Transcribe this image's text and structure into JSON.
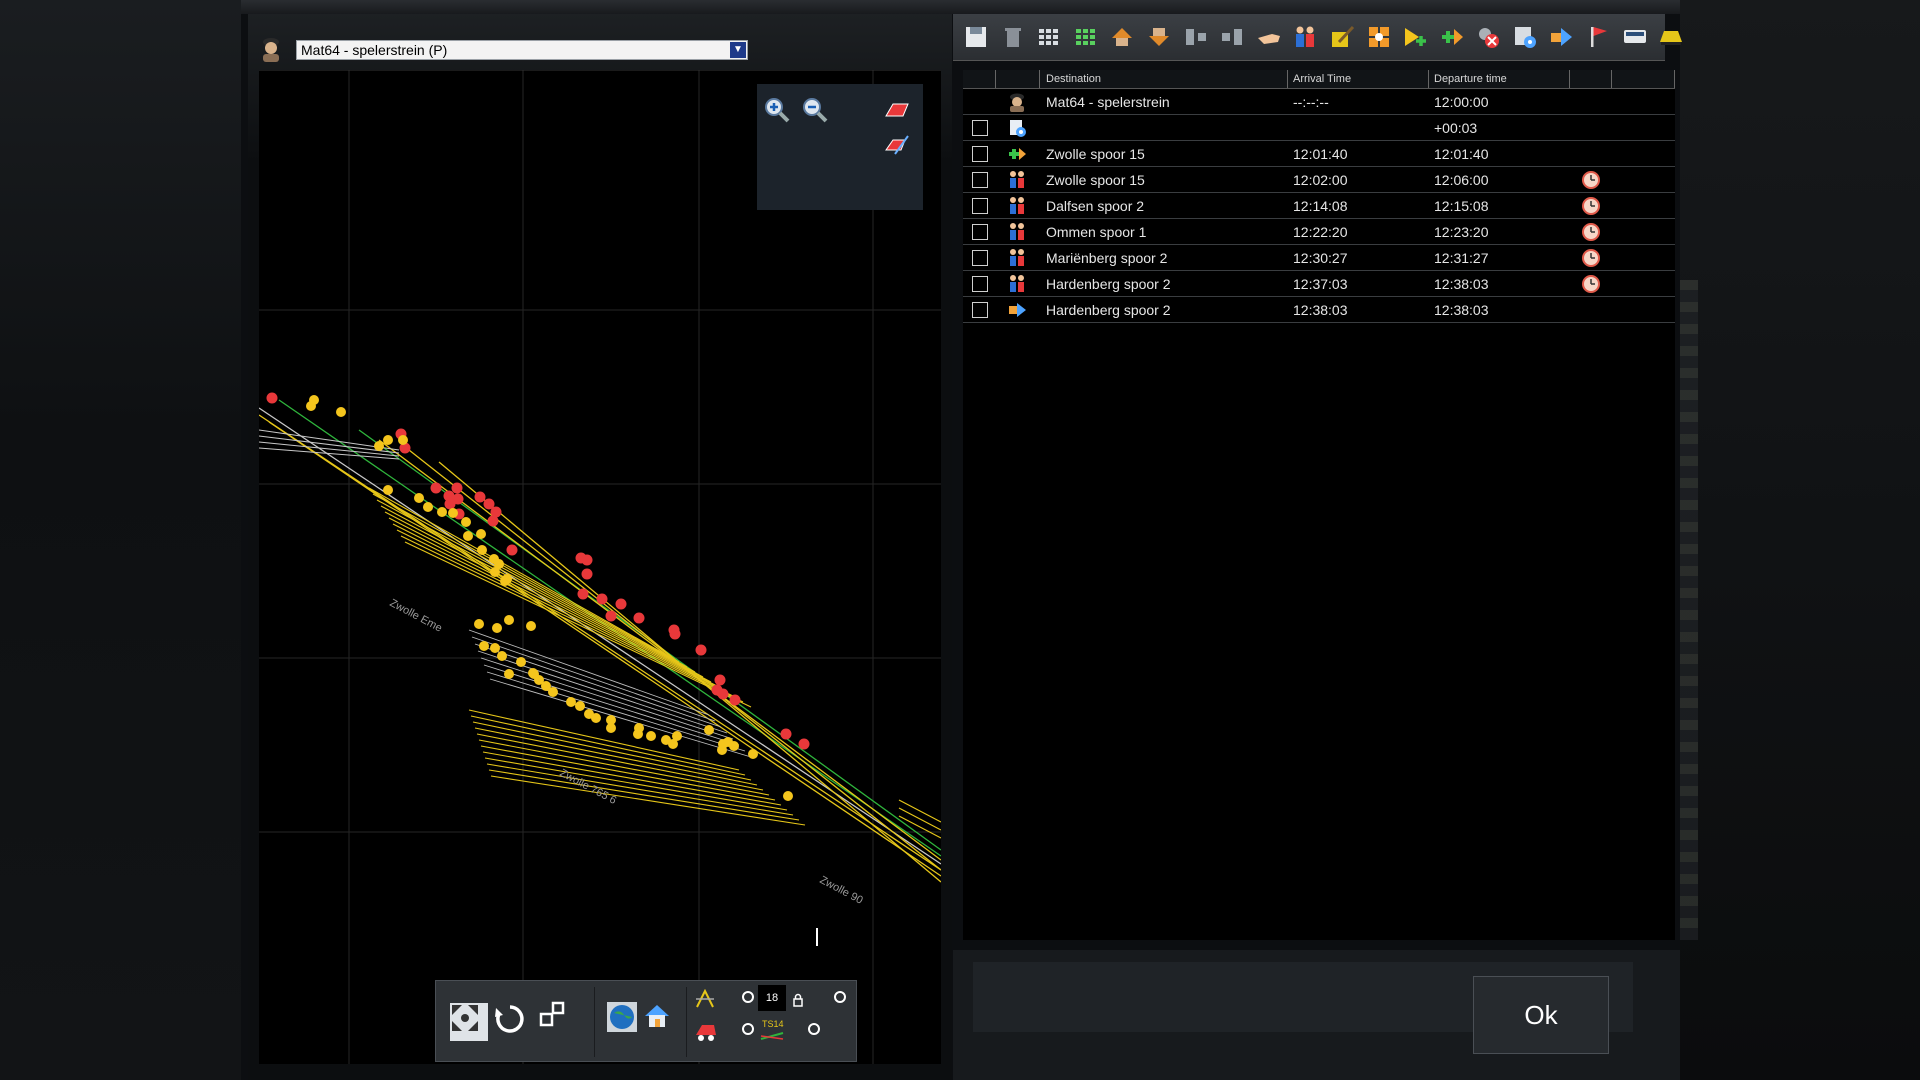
{
  "train": {
    "selected": "Mat64 - spelerstrein (P)"
  },
  "table": {
    "columns": [
      "Destination",
      "Arrival Time",
      "Departure time"
    ],
    "rows": [
      {
        "icon": "driver-icon",
        "check": false,
        "destination": "Mat64 - spelerstrein",
        "arrival": "--:--:--",
        "departure": "12:00:00",
        "clock": false
      },
      {
        "icon": "wait-settings-icon",
        "check": true,
        "destination": "",
        "arrival": "",
        "departure": "+00:03",
        "clock": false
      },
      {
        "icon": "add-route-icon",
        "check": true,
        "destination": "Zwolle spoor 15",
        "arrival": "12:01:40",
        "departure": "12:01:40",
        "clock": false
      },
      {
        "icon": "passengers-icon",
        "check": true,
        "destination": "Zwolle spoor 15",
        "arrival": "12:02:00",
        "departure": "12:06:00",
        "clock": true
      },
      {
        "icon": "passengers-icon",
        "check": true,
        "destination": "Dalfsen spoor 2",
        "arrival": "12:14:08",
        "departure": "12:15:08",
        "clock": true
      },
      {
        "icon": "passengers-icon",
        "check": true,
        "destination": "Ommen spoor 1",
        "arrival": "12:22:20",
        "departure": "12:23:20",
        "clock": true
      },
      {
        "icon": "passengers-icon",
        "check": true,
        "destination": "Mariënberg spoor 2",
        "arrival": "12:30:27",
        "departure": "12:31:27",
        "clock": true
      },
      {
        "icon": "passengers-icon",
        "check": true,
        "destination": "Hardenberg spoor 2",
        "arrival": "12:37:03",
        "departure": "12:38:03",
        "clock": true
      },
      {
        "icon": "exit-icon",
        "check": true,
        "destination": "Hardenberg spoor 2",
        "arrival": "12:38:03",
        "departure": "12:38:03",
        "clock": false
      }
    ]
  },
  "toolbar_icons": [
    "save-icon",
    "delete-icon",
    "grid-small-icon",
    "grid-green-icon",
    "move-up-icon",
    "move-down-icon",
    "merge-icon",
    "split-icon",
    "pointer-hand-icon",
    "passengers-icon",
    "edit-icon",
    "orange-grid-icon",
    "add-yellow-icon",
    "add-green-icon",
    "remove-icon",
    "settings-icon",
    "exit-icon",
    "flag-icon",
    "train-side-icon",
    "train-front-icon"
  ],
  "map": {
    "station_labels": [
      "Zwolle Eme",
      "Zwolle 765 6",
      "Zwolle 90"
    ],
    "layer_value": "18",
    "ts_label": "TS14"
  },
  "footer": {
    "ok_label": "Ok"
  },
  "colors": {
    "track_yellow": "#e6c619",
    "track_green": "#2fb53c",
    "signal_red": "#e8383a",
    "signal_yellow": "#f4c51d"
  }
}
